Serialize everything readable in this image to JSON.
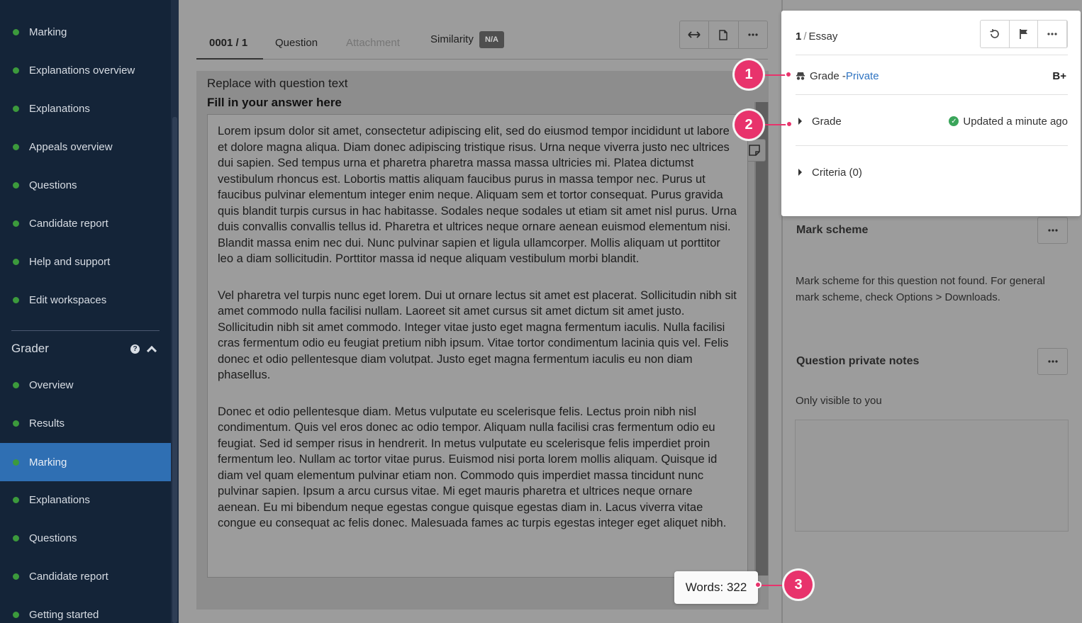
{
  "sidebar": {
    "top_items": [
      {
        "label": "Marking"
      },
      {
        "label": "Explanations overview"
      },
      {
        "label": "Explanations"
      },
      {
        "label": "Appeals overview"
      },
      {
        "label": "Questions"
      },
      {
        "label": "Candidate report"
      },
      {
        "label": "Help and support"
      },
      {
        "label": "Edit workspaces"
      }
    ],
    "section": {
      "title": "Grader",
      "help": "?"
    },
    "section_items": [
      {
        "label": "Overview"
      },
      {
        "label": "Results"
      },
      {
        "label": "Marking",
        "active": true
      },
      {
        "label": "Explanations"
      },
      {
        "label": "Questions"
      },
      {
        "label": "Candidate report"
      },
      {
        "label": "Getting started"
      }
    ]
  },
  "tabs": {
    "response": "0001 / 1",
    "question": "Question",
    "attachment": "Attachment",
    "similarity": "Similarity",
    "similarity_badge": "N/A"
  },
  "toolbar": {
    "icons": [
      "expand-horizontal-icon",
      "document-icon",
      "more-icon"
    ]
  },
  "question": {
    "text": "Replace with question text",
    "fill_label": "Fill in your answer here",
    "paragraphs": [
      "Lorem ipsum dolor sit amet, consectetur adipiscing elit, sed do eiusmod tempor incididunt ut labore et dolore magna aliqua. Diam donec adipiscing tristique risus. Urna neque viverra justo nec ultrices dui sapien. Sed tempus urna et pharetra pharetra massa massa ultricies mi. Platea dictumst vestibulum rhoncus est. Lobortis mattis aliquam faucibus purus in massa tempor nec. Purus ut faucibus pulvinar elementum integer enim neque. Aliquam sem et tortor consequat. Purus gravida quis blandit turpis cursus in hac habitasse. Sodales neque sodales ut etiam sit amet nisl purus. Urna duis convallis convallis tellus id. Pharetra et ultrices neque ornare aenean euismod elementum nisi. Blandit massa enim nec dui. Nunc pulvinar sapien et ligula ullamcorper. Mollis aliquam ut porttitor leo a diam sollicitudin. Porttitor massa id neque aliquam vestibulum morbi blandit.",
      "Vel pharetra vel turpis nunc eget lorem. Dui ut ornare lectus sit amet est placerat. Sollicitudin nibh sit amet commodo nulla facilisi nullam. Laoreet sit amet cursus sit amet dictum sit amet justo. Sollicitudin nibh sit amet commodo. Integer vitae justo eget magna fermentum iaculis. Nulla facilisi cras fermentum odio eu feugiat pretium nibh ipsum. Vitae tortor condimentum lacinia quis vel. Felis donec et odio pellentesque diam volutpat. Justo eget magna fermentum iaculis eu non diam phasellus.",
      "Donec et odio pellentesque diam. Metus vulputate eu scelerisque felis. Lectus proin nibh nisl condimentum. Quis vel eros donec ac odio tempor. Aliquam nulla facilisi cras fermentum odio eu feugiat. Sed id semper risus in hendrerit. In metus vulputate eu scelerisque felis imperdiet proin fermentum leo. Nullam ac tortor vitae purus. Euismod nisi porta lorem mollis aliquam. Quisque id diam vel quam elementum pulvinar etiam non. Commodo quis imperdiet massa tincidunt nunc pulvinar sapien. Ipsum a arcu cursus vitae. Mi eget mauris pharetra et ultrices neque ornare aenean. Eu mi bibendum neque egestas congue quisque egestas diam in. Lacus viverra vitae congue eu consequat ac felis donec. Malesuada fames ac turpis egestas integer eget aliquet nibh."
    ],
    "words": "Words: 322"
  },
  "card": {
    "num": "1",
    "sep": "/",
    "type": "Essay",
    "grade_label": "Grade - ",
    "grade_private": "Private",
    "grade_value": "B+",
    "grade_row": "Grade",
    "updated": "Updated a minute ago",
    "criteria": "Criteria (0)"
  },
  "mark_scheme": {
    "title": "Mark scheme",
    "text": "Mark scheme for this question not found. For general mark scheme, check Options > Downloads."
  },
  "notes": {
    "title": "Question private notes",
    "subtitle": "Only visible to you"
  },
  "callouts": [
    "1",
    "2",
    "3"
  ],
  "colors": {
    "sidebar": "#142438",
    "active": "#2f6fb3",
    "accent": "#e8336c",
    "link": "#2f74c2",
    "status": "#3c9a3c"
  }
}
